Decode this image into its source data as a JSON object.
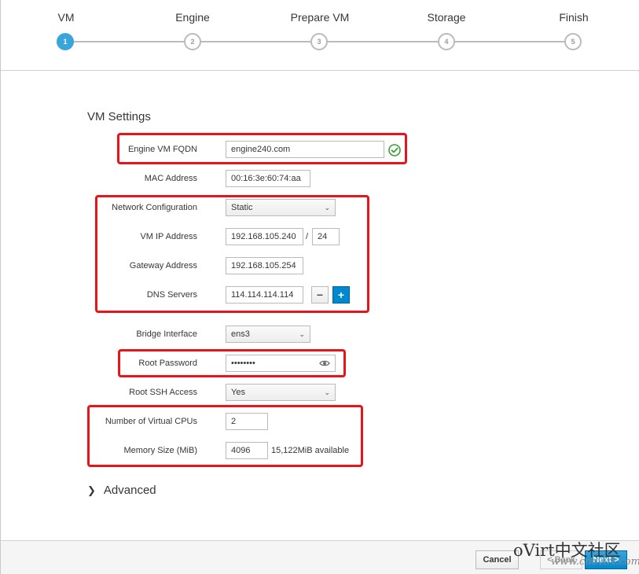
{
  "wizard": {
    "steps": [
      {
        "label": "VM",
        "number": "1",
        "active": true
      },
      {
        "label": "Engine",
        "number": "2",
        "active": false
      },
      {
        "label": "Prepare VM",
        "number": "3",
        "active": false
      },
      {
        "label": "Storage",
        "number": "4",
        "active": false
      },
      {
        "label": "Finish",
        "number": "5",
        "active": false
      }
    ]
  },
  "vm_settings": {
    "title": "VM Settings",
    "engine_fqdn": {
      "label": "Engine VM FQDN",
      "value": "engine240.com",
      "valid_icon": "check-circle-icon"
    },
    "mac_address": {
      "label": "MAC Address",
      "value": "00:16:3e:60:74:aa"
    },
    "network_config": {
      "label": "Network Configuration",
      "value": "Static"
    },
    "vm_ip": {
      "label": "VM IP Address",
      "value": "192.168.105.240",
      "separator": "/",
      "prefix": "24"
    },
    "gateway": {
      "label": "Gateway Address",
      "value": "192.168.105.254"
    },
    "dns": {
      "label": "DNS Servers",
      "value": "114.114.114.114",
      "remove_label": "−",
      "add_label": "+"
    },
    "bridge": {
      "label": "Bridge Interface",
      "value": "ens3"
    },
    "root_password": {
      "label": "Root Password",
      "value": "••••••••",
      "reveal_icon": "eye-icon"
    },
    "root_ssh": {
      "label": "Root SSH Access",
      "value": "Yes"
    },
    "vcpus": {
      "label": "Number of Virtual CPUs",
      "value": "2"
    },
    "memory": {
      "label": "Memory Size (MiB)",
      "value": "4096",
      "available": "15,122MiB available"
    },
    "advanced": {
      "label": "Advanced",
      "icon": "chevron-right-icon"
    }
  },
  "footer": {
    "cancel_label": "Cancel",
    "back_label": "< Back",
    "next_label": "Next >"
  },
  "watermark": {
    "brand": "oVirt中文社区",
    "url": "www.cnovirt.com"
  },
  "colors": {
    "accent": "#39a5dc",
    "highlight_box": "#e8141a",
    "primary_button": "#0088ce",
    "valid_green": "#3f9c35"
  }
}
